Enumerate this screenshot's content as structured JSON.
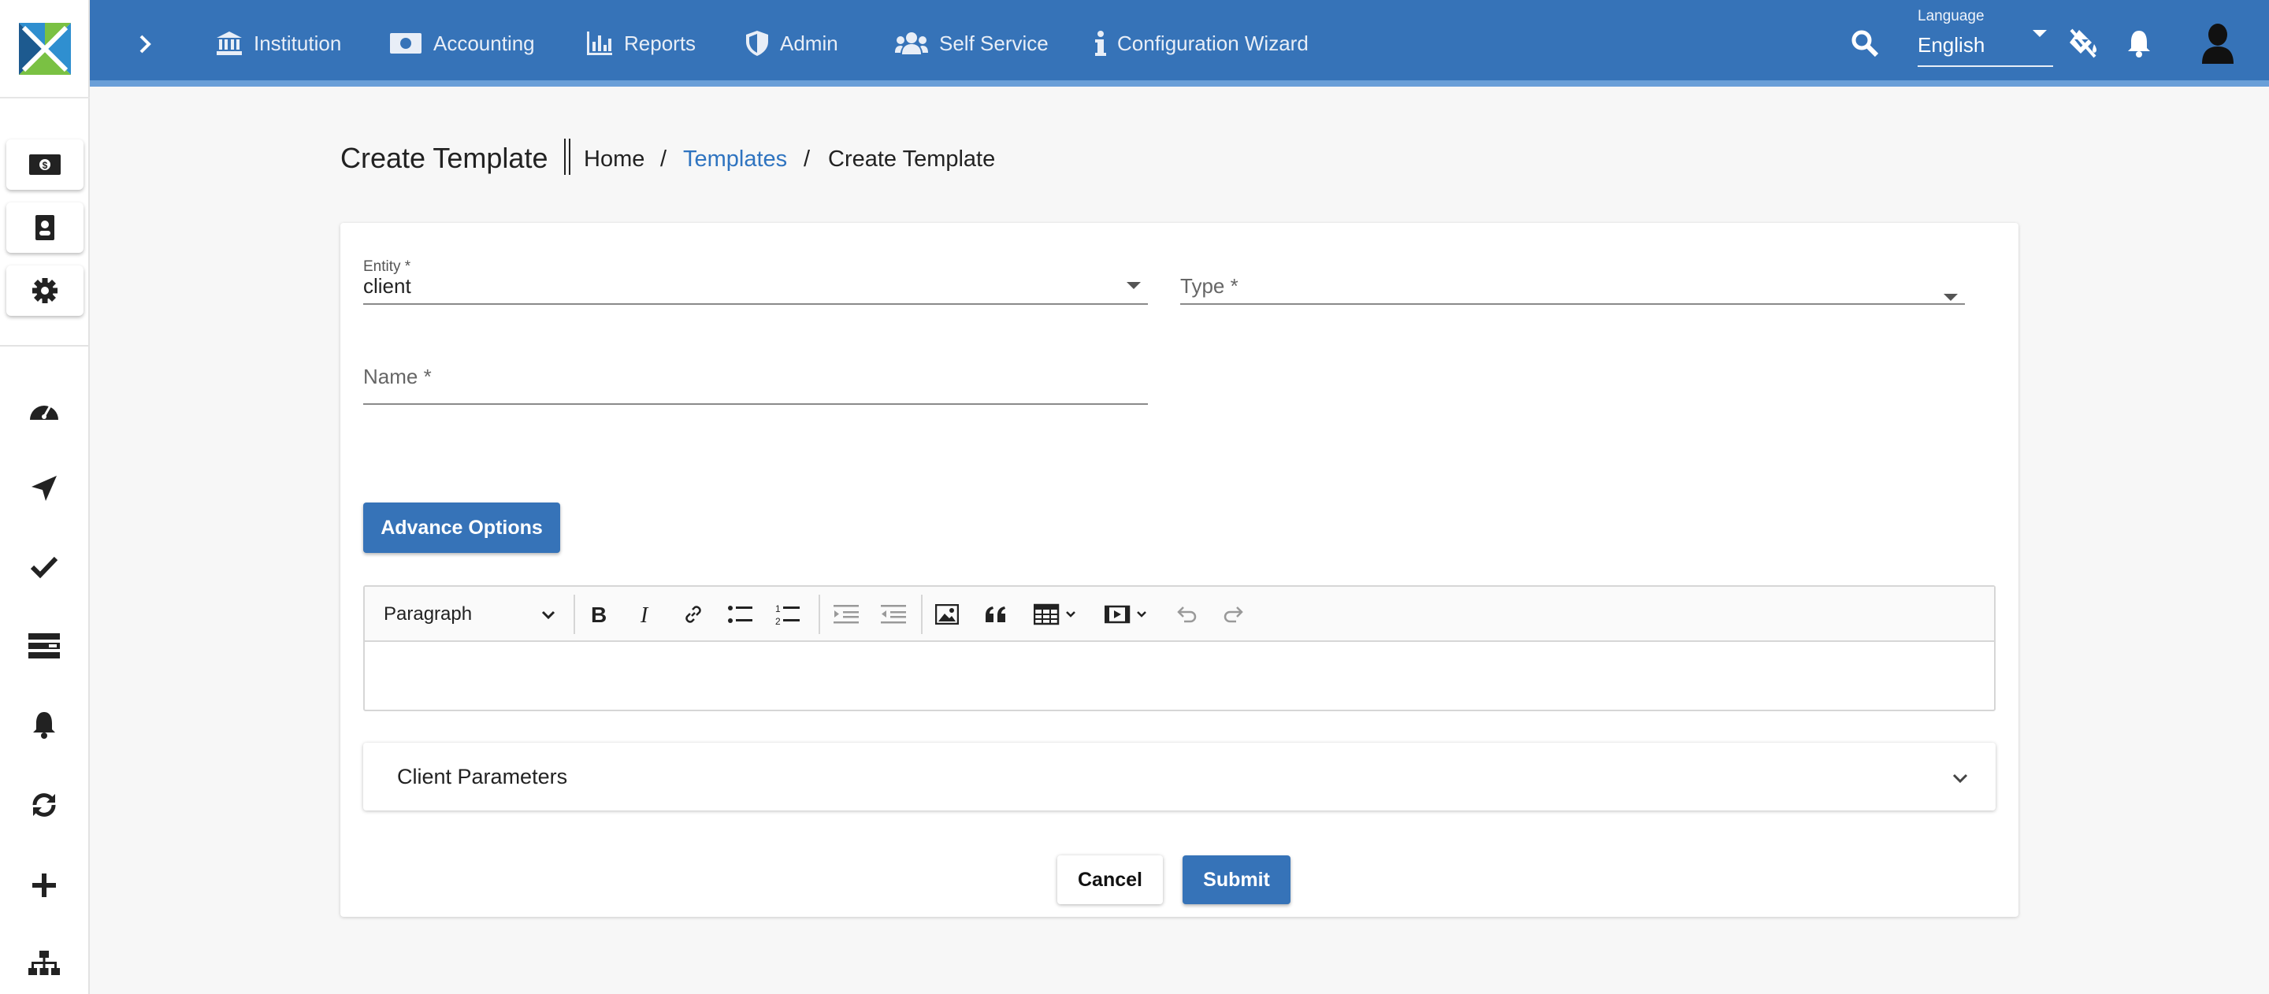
{
  "topbar": {
    "nav": [
      {
        "label": "Institution",
        "icon": "bank-icon"
      },
      {
        "label": "Accounting",
        "icon": "money-icon"
      },
      {
        "label": "Reports",
        "icon": "bar-chart-icon"
      },
      {
        "label": "Admin",
        "icon": "shield-icon"
      },
      {
        "label": "Self Service",
        "icon": "users-icon"
      },
      {
        "label": "Configuration Wizard",
        "icon": "info-icon"
      }
    ],
    "language_label": "Language",
    "language_value": "English"
  },
  "breadcrumb": {
    "title": "Create Template",
    "items": [
      "Home",
      "Templates",
      "Create Template"
    ],
    "separator": "/"
  },
  "form": {
    "entity_label": "Entity *",
    "entity_value": "client",
    "type_placeholder": "Type *",
    "name_placeholder": "Name *",
    "advance_options_label": "Advance Options",
    "editor": {
      "paragraph_select": "Paragraph"
    },
    "panel_title": "Client Parameters",
    "cancel_label": "Cancel",
    "submit_label": "Submit"
  },
  "colors": {
    "primary": "#3673b8",
    "link": "#2f74c0",
    "topbar_border": "#6a9fd8"
  }
}
